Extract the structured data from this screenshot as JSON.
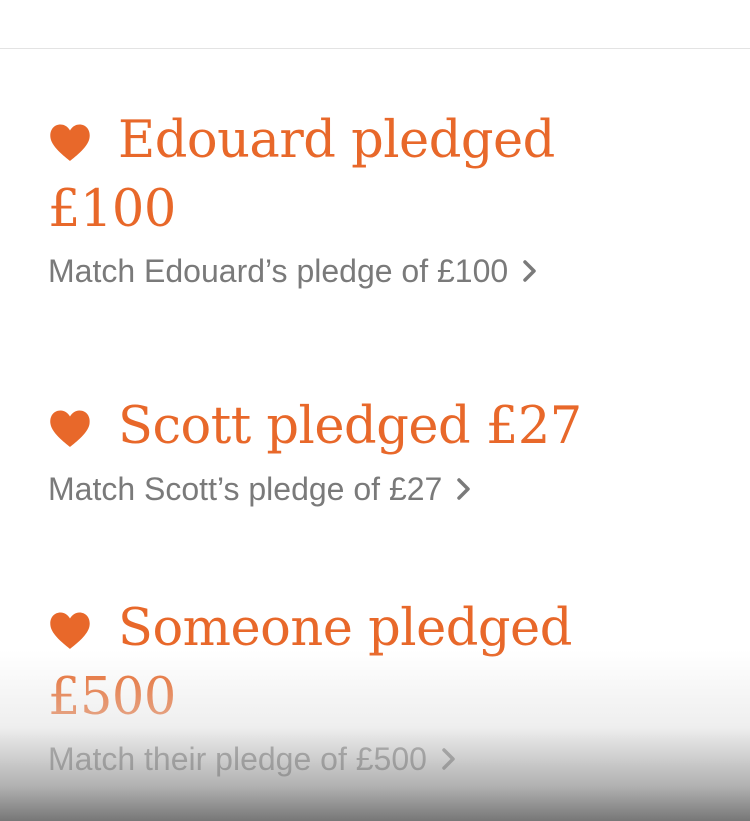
{
  "colors": {
    "accent": "#e8682a",
    "muted_text": "#7a7a7a",
    "divider": "#e3e3e3"
  },
  "pledges": [
    {
      "icon": "heart-icon",
      "title": "Edouard pledged",
      "amount": "£100",
      "match_label": "Match Edouard’s pledge of £100"
    },
    {
      "icon": "heart-icon",
      "title": "Scott pledged £27",
      "match_label": "Match Scott’s pledge of £27"
    },
    {
      "icon": "heart-icon",
      "title": "Someone pledged",
      "amount": "£500",
      "match_label": "Match their pledge of £500"
    }
  ]
}
